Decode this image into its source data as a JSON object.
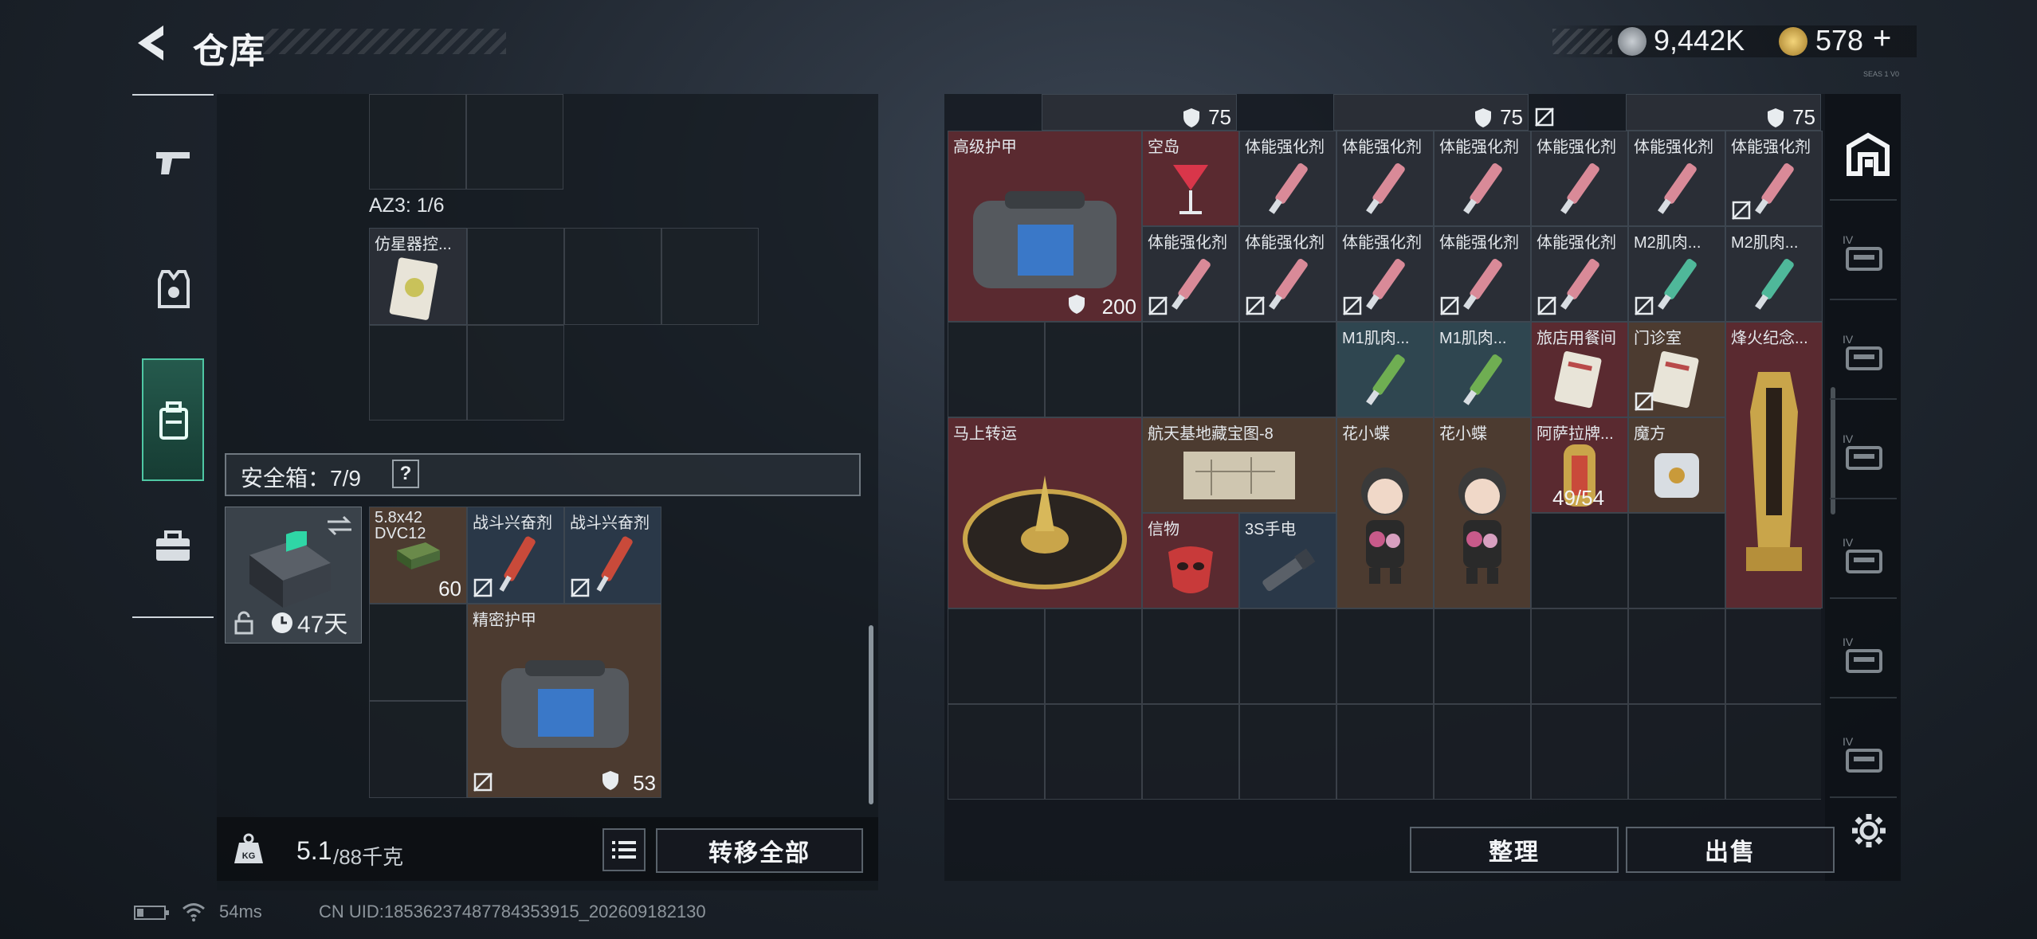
{
  "header": {
    "title": "仓库",
    "currency1": "9,442K",
    "currency2": "578",
    "plus": "+",
    "tiny_label": "SEAS 1 V0"
  },
  "left": {
    "az3_label": "AZ3: 1/6",
    "top_item": {
      "label": "仿星器控..."
    },
    "safe_box": {
      "label": "安全箱：7/9",
      "help": "?",
      "days": "47天"
    },
    "safe_items": [
      {
        "label": "5.8x42 DVC12",
        "count": "60"
      },
      {
        "label": "战斗兴奋剂"
      },
      {
        "label": "战斗兴奋剂"
      },
      {
        "label": "精密护甲",
        "durability": "53"
      }
    ],
    "weight": {
      "current": "5.1",
      "max": "/88千克"
    },
    "transfer_all": "转移全部"
  },
  "right": {
    "top_row": [
      {
        "durability": "75"
      },
      {
        "durability": "75"
      },
      {
        "durability": "75"
      }
    ],
    "items": [
      {
        "key": "armor",
        "label": "高级护甲",
        "durability": "200"
      },
      {
        "key": "kongdao",
        "label": "空岛"
      },
      {
        "key": "s1",
        "label": "体能强化剂"
      },
      {
        "key": "s2",
        "label": "体能强化剂"
      },
      {
        "key": "s3",
        "label": "体能强化剂"
      },
      {
        "key": "s4",
        "label": "体能强化剂"
      },
      {
        "key": "s5",
        "label": "体能强化剂"
      },
      {
        "key": "s6",
        "label": "体能强化剂"
      },
      {
        "key": "s7",
        "label": "体能强化剂"
      },
      {
        "key": "s8",
        "label": "体能强化剂"
      },
      {
        "key": "s9",
        "label": "体能强化剂"
      },
      {
        "key": "s10",
        "label": "体能强化剂"
      },
      {
        "key": "s11",
        "label": "体能强化剂"
      },
      {
        "key": "m2a",
        "label": "M2肌肉..."
      },
      {
        "key": "m2b",
        "label": "M2肌肉..."
      },
      {
        "key": "m1a",
        "label": "M1肌肉..."
      },
      {
        "key": "m1b",
        "label": "M1肌肉..."
      },
      {
        "key": "hotel",
        "label": "旅店用餐间"
      },
      {
        "key": "clinic",
        "label": "门诊室"
      },
      {
        "key": "fire",
        "label": "烽火纪念..."
      },
      {
        "key": "mashang",
        "label": "马上转运"
      },
      {
        "key": "map",
        "label": "航天基地藏宝图-8"
      },
      {
        "key": "flower1",
        "label": "花小蝶"
      },
      {
        "key": "flower2",
        "label": "花小蝶"
      },
      {
        "key": "asala",
        "label": "阿萨拉牌...",
        "count": "49/54"
      },
      {
        "key": "mofang",
        "label": "魔方"
      },
      {
        "key": "xinwu",
        "label": "信物"
      },
      {
        "key": "3s",
        "label": "3S手电"
      }
    ],
    "sort_button": "整理",
    "sell_button": "出售"
  },
  "footer": {
    "ping": "54ms",
    "uid": "CN UID:18536237487784353915_202609182130"
  }
}
